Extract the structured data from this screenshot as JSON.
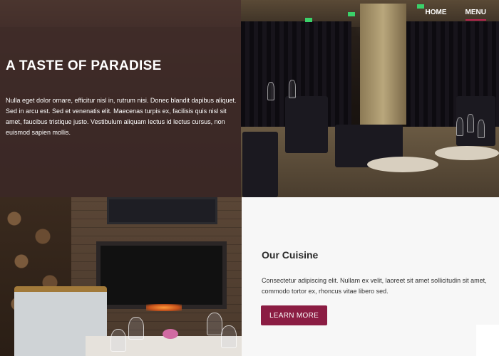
{
  "nav": {
    "items": [
      {
        "label": "HOME",
        "active": false
      },
      {
        "label": "MENU",
        "active": true
      }
    ]
  },
  "hero": {
    "title": "A TASTE OF PARADISE",
    "text": "Nulla eget dolor ornare, efficitur nisl in, rutrum nisi. Donec blandit dapibus aliquet. Sed in arcu est. Sed et venenatis elit. Maecenas turpis ex, facilisis quis nisl sit amet, faucibus tristique justo. Vestibulum aliquam lectus id lectus cursus, non euismod sapien mollis."
  },
  "cuisine": {
    "title": "Our Cuisine",
    "text": "Consectetur adipiscing elit. Nullam ex velit, laoreet sit amet sollicitudin sit amet, commodo tortor ex, rhoncus vitae libero sed.",
    "button_label": "LEARN MORE"
  },
  "colors": {
    "accent": "#8b1d43",
    "nav_underline": "#b8234f",
    "hero_overlay": "#46302d"
  }
}
